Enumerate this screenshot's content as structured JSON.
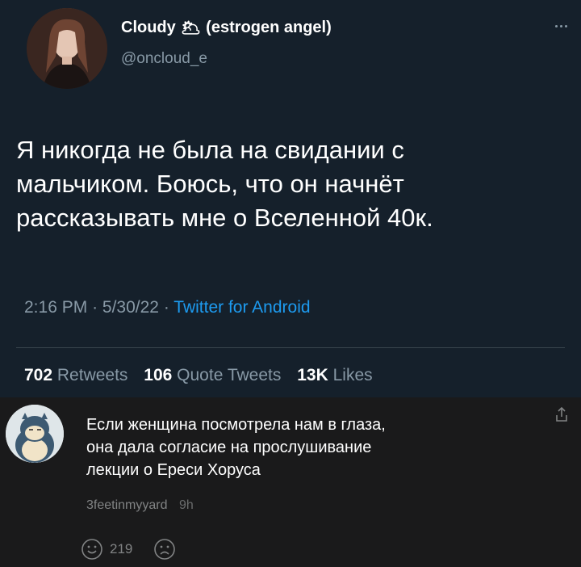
{
  "tweet": {
    "display_name": "Cloudy",
    "display_name_emoji": "🌥",
    "display_name_suffix": "(estrogen angel)",
    "handle": "@oncloud_e",
    "text_lines": [
      "Я никогда не была на свидании с",
      "мальчиком. Боюсь, что он начнёт",
      "рассказывать мне о Вселенной 40к."
    ],
    "time": "2:16 PM",
    "date": "5/30/22",
    "separator": "·",
    "source": "Twitter for Android",
    "retweets_count": "702",
    "retweets_label": "Retweets",
    "quotes_count": "106",
    "quotes_label": "Quote Tweets",
    "likes_count": "13K",
    "likes_label": "Likes"
  },
  "comment": {
    "text_lines": [
      "Если женщина посмотрела нам в глаза,",
      "она дала согласие на прослушивание",
      "лекции о Ереси Хоруса"
    ],
    "username": "3feetinmyyard",
    "age": "9h",
    "upvote_count": "219"
  },
  "icons": {
    "more": "more-horizontal-icon",
    "share": "share-icon",
    "upvote": "smile-face-icon",
    "downvote": "frown-face-icon"
  },
  "colors": {
    "tweet_bg": "#15202b",
    "comment_bg": "#1a1a1b",
    "muted_text": "#8899a6",
    "link_blue": "#1d9bf0"
  }
}
